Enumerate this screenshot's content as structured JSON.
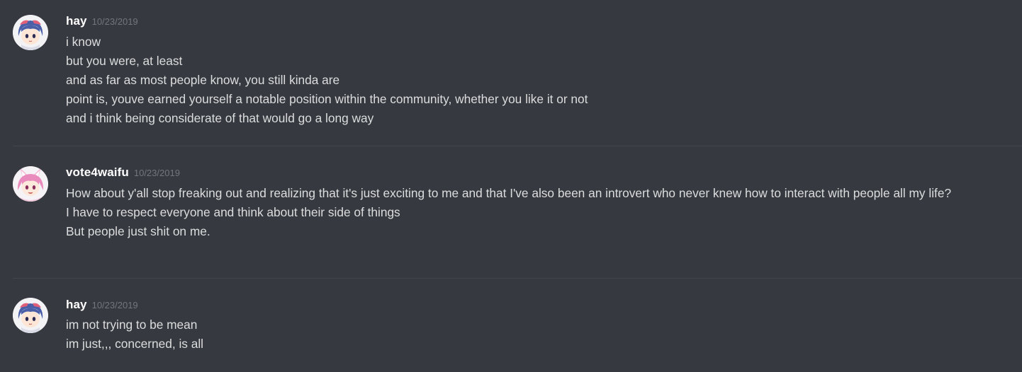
{
  "messages": [
    {
      "username": "hay",
      "timestamp": "10/23/2019",
      "avatar_icon": "anime-girl-avatar-blue-hair",
      "lines": [
        "i know",
        "but you were, at least",
        "and as far as most people know, you still kinda are",
        "point is, youve earned yourself a notable position within the community, whether you like it or not",
        "and i think being considerate of that would go a long way"
      ]
    },
    {
      "username": "vote4waifu",
      "timestamp": "10/23/2019",
      "avatar_icon": "anime-girl-avatar-pink-hair",
      "lines": [
        "How about y'all stop freaking out and realizing that it's just exciting to me and that I've also been an introvert who never knew how to interact with people all my life?",
        "I have to respect everyone and think about their side of things",
        "But people just shit on me."
      ]
    },
    {
      "username": "hay",
      "timestamp": "10/23/2019",
      "avatar_icon": "anime-girl-avatar-blue-hair",
      "lines": [
        "im not trying to be mean",
        "im just,,, concerned, is all"
      ]
    }
  ],
  "colors": {
    "background": "#36393f",
    "username": "#ffffff",
    "timestamp": "#72767d",
    "text": "#dcddde",
    "divider": "#42454a"
  }
}
